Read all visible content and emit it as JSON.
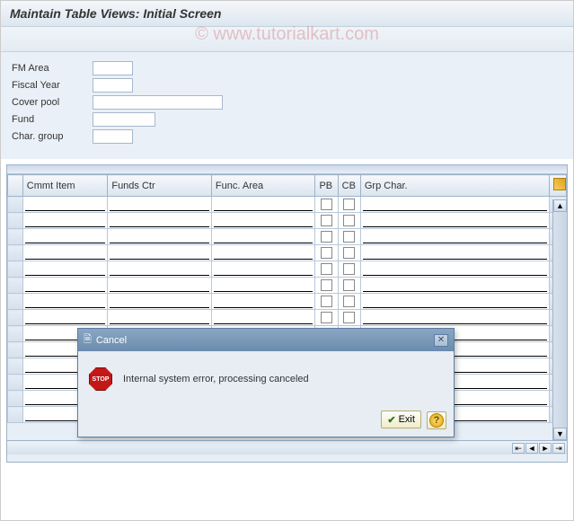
{
  "title": "Maintain Table Views: Initial Screen",
  "watermark": "© www.tutorialkart.com",
  "form": {
    "fm_area_label": "FM Area",
    "fiscal_year_label": "Fiscal Year",
    "cover_pool_label": "Cover pool",
    "fund_label": "Fund",
    "char_group_label": "Char. group",
    "fm_area_value": "",
    "fiscal_year_value": "",
    "cover_pool_value": "",
    "fund_value": "",
    "char_group_value": ""
  },
  "table": {
    "columns": {
      "cmmt_item": "Cmmt Item",
      "funds_ctr": "Funds Ctr",
      "func_area": "Func. Area",
      "pb": "PB",
      "cb": "CB",
      "grp_char": "Grp Char."
    },
    "rows": [
      {
        "cmmt": "",
        "funds": "",
        "func": "",
        "pb": false,
        "cb": false,
        "grp": ""
      },
      {
        "cmmt": "",
        "funds": "",
        "func": "",
        "pb": false,
        "cb": false,
        "grp": ""
      },
      {
        "cmmt": "",
        "funds": "",
        "func": "",
        "pb": false,
        "cb": false,
        "grp": ""
      },
      {
        "cmmt": "",
        "funds": "",
        "func": "",
        "pb": false,
        "cb": false,
        "grp": ""
      },
      {
        "cmmt": "",
        "funds": "",
        "func": "",
        "pb": false,
        "cb": false,
        "grp": ""
      },
      {
        "cmmt": "",
        "funds": "",
        "func": "",
        "pb": false,
        "cb": false,
        "grp": ""
      },
      {
        "cmmt": "",
        "funds": "",
        "func": "",
        "pb": false,
        "cb": false,
        "grp": ""
      },
      {
        "cmmt": "",
        "funds": "",
        "func": "",
        "pb": false,
        "cb": false,
        "grp": ""
      },
      {
        "cmmt": "",
        "funds": "",
        "func": "",
        "pb": false,
        "cb": false,
        "grp": ""
      },
      {
        "cmmt": "",
        "funds": "",
        "func": "",
        "pb": false,
        "cb": false,
        "grp": ""
      },
      {
        "cmmt": "",
        "funds": "",
        "func": "",
        "pb": false,
        "cb": false,
        "grp": ""
      },
      {
        "cmmt": "",
        "funds": "",
        "func": "",
        "pb": false,
        "cb": false,
        "grp": ""
      },
      {
        "cmmt": "",
        "funds": "",
        "func": "",
        "pb": false,
        "cb": false,
        "grp": ""
      },
      {
        "cmmt": "",
        "funds": "",
        "func": "",
        "pb": false,
        "cb": false,
        "grp": ""
      }
    ]
  },
  "dialog": {
    "title": "Cancel",
    "stop_text": "STOP",
    "message": "Internal system error, processing canceled",
    "exit_label": "Exit"
  }
}
